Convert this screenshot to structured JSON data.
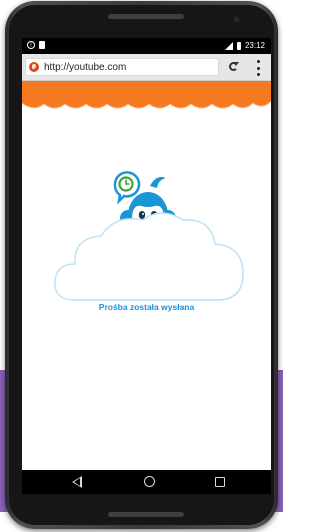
{
  "status_bar": {
    "time": "23:12",
    "sim_icon": "sim-icon",
    "sd_card_icon": "sd-card-icon",
    "signal_icon": "signal-icon",
    "battery_icon": "battery-icon"
  },
  "browser": {
    "url": "http://youtube.com",
    "favicon": "globe-icon",
    "reload_icon": "reload-icon",
    "menu_icon": "overflow-menu-icon"
  },
  "page": {
    "message": "Prośba została wysłana",
    "mascot": "monkey-mascot",
    "clock_badge": "clock-icon"
  },
  "navigation": {
    "back_icon": "back-icon",
    "home_icon": "home-icon",
    "recents_icon": "recents-icon"
  },
  "colors": {
    "header_orange": "#f47920",
    "mascot_blue": "#1a96d4",
    "clock_green": "#3aa635",
    "message_blue": "#1f8fd6",
    "backdrop_purple": "#8a63b8"
  }
}
